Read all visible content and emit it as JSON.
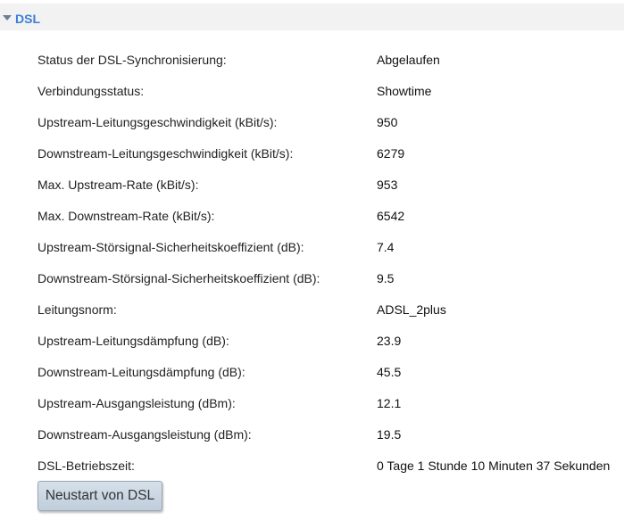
{
  "section": {
    "title": "DSL",
    "toggle_icon": "triangle-down-icon"
  },
  "rows": [
    {
      "label": "Status der DSL-Synchronisierung:",
      "value": "Abgelaufen"
    },
    {
      "label": "Verbindungsstatus:",
      "value": "Showtime"
    },
    {
      "label": "Upstream-Leitungsgeschwindigkeit (kBit/s):",
      "value": "950"
    },
    {
      "label": "Downstream-Leitungsgeschwindigkeit (kBit/s):",
      "value": "6279"
    },
    {
      "label": "Max. Upstream-Rate (kBit/s):",
      "value": "953"
    },
    {
      "label": "Max. Downstream-Rate (kBit/s):",
      "value": "6542"
    },
    {
      "label": "Upstream-Störsignal-Sicherheitskoeffizient (dB):",
      "value": "7.4"
    },
    {
      "label": "Downstream-Störsignal-Sicherheitskoeffizient (dB):",
      "value": "9.5"
    },
    {
      "label": "Leitungsnorm:",
      "value": "ADSL_2plus"
    },
    {
      "label": "Upstream-Leitungsdämpfung (dB):",
      "value": "23.9"
    },
    {
      "label": "Downstream-Leitungsdämpfung (dB):",
      "value": "45.5"
    },
    {
      "label": "Upstream-Ausgangsleistung (dBm):",
      "value": "12.1"
    },
    {
      "label": "Downstream-Ausgangsleistung (dBm):",
      "value": "19.5"
    },
    {
      "label": "DSL-Betriebszeit:",
      "value": "0 Tage 1 Stunde 10 Minuten 37 Sekunden"
    }
  ],
  "actions": {
    "restart_label": "Neustart von DSL"
  },
  "colors": {
    "accent": "#3a7fd6",
    "header_bg": "#f2f2f2",
    "button_bg": "#c9d6e3"
  }
}
